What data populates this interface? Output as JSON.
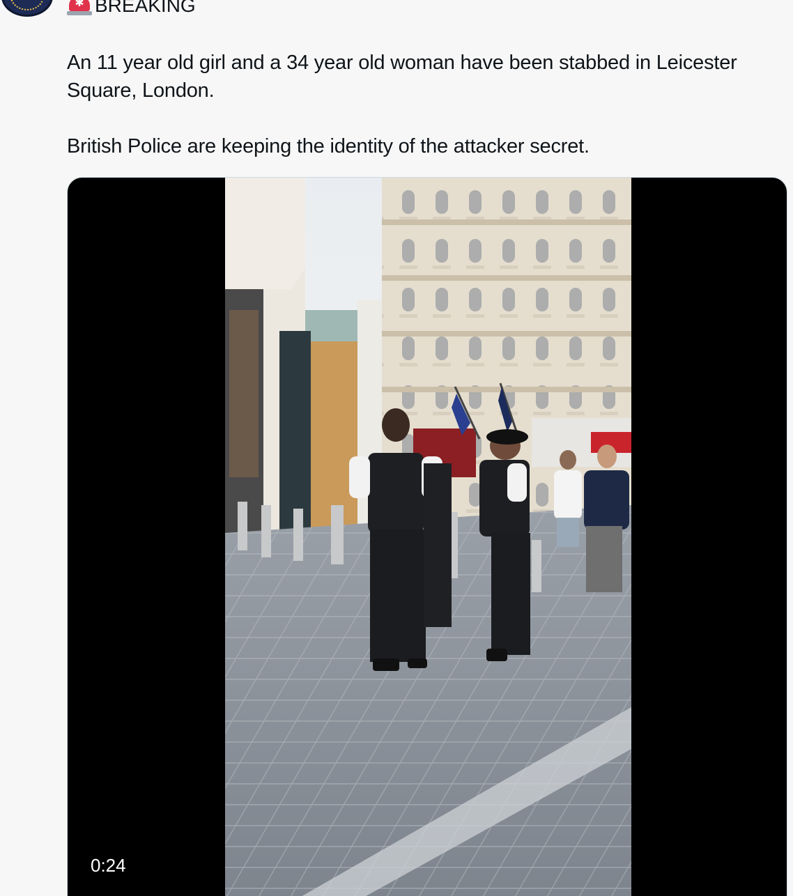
{
  "post": {
    "headline": "BREAKING",
    "headline_icon": "police-light-icon",
    "paragraphs": [
      "An 11 year old girl and a 34 year old woman have been stabbed in Leicester Square, London.",
      "British Police are keeping the identity of the attacker secret."
    ]
  },
  "video": {
    "timestamp": "0:24"
  },
  "colors": {
    "background": "#f7f7f7",
    "text": "#0f1419",
    "siren": "#e0324b",
    "avatar": "#1d2b55"
  }
}
